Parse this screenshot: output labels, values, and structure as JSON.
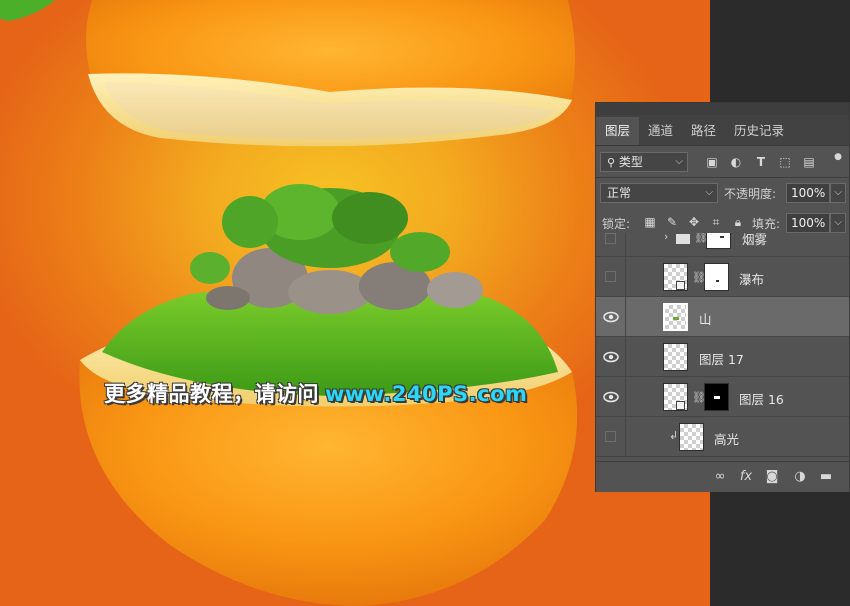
{
  "canvas": {
    "watermark_text": "更多精品教程，请访问",
    "watermark_url": "www.240PS.com"
  },
  "layers_panel": {
    "tabs": [
      {
        "label": "图层",
        "active": true
      },
      {
        "label": "通道",
        "active": false
      },
      {
        "label": "路径",
        "active": false
      },
      {
        "label": "历史记录",
        "active": false
      }
    ],
    "filter_kind": "类型",
    "blend_mode": "正常",
    "opacity_label": "不透明度:",
    "opacity_value": "100%",
    "lock_label": "锁定:",
    "fill_label": "填充:",
    "fill_value": "100%",
    "layers": [
      {
        "name": "烟雾",
        "visible": false,
        "type": "group",
        "selected": false
      },
      {
        "name": "瀑布",
        "visible": false,
        "type": "smart-with-mask",
        "selected": false
      },
      {
        "name": "山",
        "visible": true,
        "type": "image",
        "selected": true
      },
      {
        "name": "图层 17",
        "visible": true,
        "type": "image",
        "selected": false
      },
      {
        "name": "图层 16",
        "visible": true,
        "type": "smart-with-mask",
        "selected": false
      },
      {
        "name": "高光",
        "visible": false,
        "type": "clipped",
        "selected": false
      }
    ]
  }
}
